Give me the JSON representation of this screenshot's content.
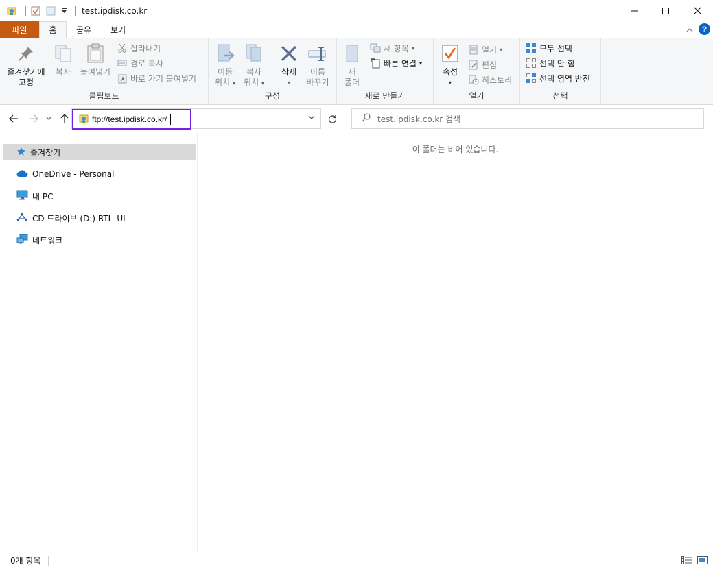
{
  "window": {
    "title": "test.ipdisk.co.kr"
  },
  "tabs": [
    {
      "label": "파일"
    },
    {
      "label": "홈"
    },
    {
      "label": "공유"
    },
    {
      "label": "보기"
    }
  ],
  "ribbon": {
    "clipboard": {
      "label": "클립보드",
      "pin_line1": "즐겨찾기에",
      "pin_line2": "고정",
      "copy": "복사",
      "paste": "붙여넣기",
      "cut": "잘라내기",
      "copy_path": "경로 복사",
      "paste_shortcut": "바로 가기 붙여넣기"
    },
    "organize": {
      "label": "구성",
      "move_line1": "이동",
      "move_line2": "위치",
      "copyto_line1": "복사",
      "copyto_line2": "위치",
      "delete": "삭제",
      "rename_line1": "이름",
      "rename_line2": "바꾸기"
    },
    "new": {
      "label": "새로 만들기",
      "folder_line1": "새",
      "folder_line2": "폴더",
      "new_item": "새 항목",
      "easy_access": "빠른 연결"
    },
    "open": {
      "label": "열기",
      "properties": "속성",
      "open": "열기",
      "edit": "편집",
      "history": "히스토리"
    },
    "select": {
      "label": "선택",
      "select_all": "모두 선택",
      "select_none": "선택 안 함",
      "invert": "선택 영역 반전"
    }
  },
  "address": {
    "value": "ftp://test.ipdisk.co.kr/"
  },
  "search": {
    "placeholder": "test.ipdisk.co.kr 검색"
  },
  "navpane": {
    "items": [
      {
        "label": "즐겨찾기",
        "icon": "star-icon"
      },
      {
        "label": "OneDrive - Personal",
        "icon": "cloud-icon"
      },
      {
        "label": "내 PC",
        "icon": "monitor-icon"
      },
      {
        "label": "CD 드라이브 (D:) RTL_UL",
        "icon": "usb-drive-icon"
      },
      {
        "label": "네트워크",
        "icon": "network-icon"
      }
    ]
  },
  "content": {
    "empty_message": "이 폴더는 비어 있습니다."
  },
  "status": {
    "item_count": "0개 항목"
  },
  "colors": {
    "file_tab": "#c55a11",
    "address_focus": "#7b1fe6",
    "accent_blue": "#0a64c8",
    "selected_nav": "#d9d9d9"
  }
}
